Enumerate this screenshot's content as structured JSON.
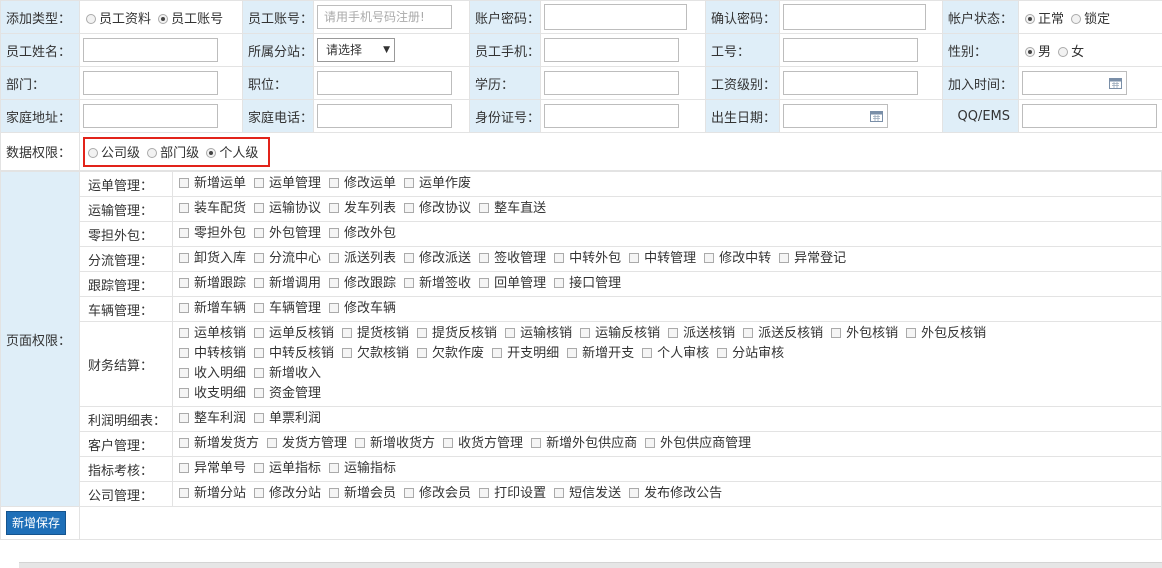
{
  "row1": {
    "add_type_label": "添加类型：",
    "add_type_options": [
      "员工资料",
      "员工账号"
    ],
    "account_label": "员工账号：",
    "account_placeholder": "请用手机号码注册!",
    "password_label": "账户密码：",
    "confirm_label": "确认密码：",
    "status_label": "帐户状态：",
    "status_options": [
      "正常",
      "锁定"
    ]
  },
  "row2": {
    "name_label": "员工姓名：",
    "branch_label": "所属分站：",
    "branch_value": "请选择",
    "mobile_label": "员工手机：",
    "job_no_label": "工号：",
    "gender_label": "性别：",
    "gender_options": [
      "男",
      "女"
    ]
  },
  "row3": {
    "dept_label": "部门：",
    "position_label": "职位：",
    "education_label": "学历：",
    "salary_label": "工资级别：",
    "join_label": "加入时间："
  },
  "row4": {
    "address_label": "家庭地址：",
    "phone_label": "家庭电话：",
    "id_label": "身份证号：",
    "birth_label": "出生日期：",
    "qq_label": "QQ/EMS"
  },
  "data_perm": {
    "label": "数据权限：",
    "options": [
      "公司级",
      "部门级",
      "个人级"
    ]
  },
  "page_perm": {
    "label": "页面权限：",
    "groups": [
      {
        "name": "运单管理：",
        "items": [
          "新增运单",
          "运单管理",
          "修改运单",
          "运单作废"
        ]
      },
      {
        "name": "运输管理：",
        "items": [
          "装车配货",
          "运输协议",
          "发车列表",
          "修改协议",
          "整车直送"
        ]
      },
      {
        "name": "零担外包：",
        "items": [
          "零担外包",
          "外包管理",
          "修改外包"
        ]
      },
      {
        "name": "分流管理：",
        "items": [
          "卸货入库",
          "分流中心",
          "派送列表",
          "修改派送",
          "签收管理",
          "中转外包",
          "中转管理",
          "修改中转",
          "异常登记"
        ]
      },
      {
        "name": "跟踪管理：",
        "items": [
          "新增跟踪",
          "新增调用",
          "修改跟踪",
          "新增签收",
          "回单管理",
          "接口管理"
        ]
      },
      {
        "name": "车辆管理：",
        "items": [
          "新增车辆",
          "车辆管理",
          "修改车辆"
        ]
      },
      {
        "name": "财务结算：",
        "lines": [
          [
            "运单核销",
            "运单反核销",
            "提货核销",
            "提货反核销",
            "运输核销",
            "运输反核销",
            "派送核销",
            "派送反核销",
            "外包核销",
            "外包反核销"
          ],
          [
            "中转核销",
            "中转反核销",
            "欠款核销",
            "欠款作废",
            "开支明细",
            "新增开支",
            "个人审核",
            "分站审核"
          ],
          [
            "收入明细",
            "新增收入"
          ],
          [
            "收支明细",
            "资金管理"
          ]
        ]
      },
      {
        "name": "利润明细表：",
        "items": [
          "整车利润",
          "单票利润"
        ]
      },
      {
        "name": "客户管理：",
        "items": [
          "新增发货方",
          "发货方管理",
          "新增收货方",
          "收货方管理",
          "新增外包供应商",
          "外包供应商管理"
        ]
      },
      {
        "name": "指标考核：",
        "items": [
          "异常单号",
          "运单指标",
          "运输指标"
        ]
      },
      {
        "name": "公司管理：",
        "items": [
          "新增分站",
          "修改分站",
          "新增会员",
          "修改会员",
          "打印设置",
          "短信发送",
          "发布修改公告"
        ]
      }
    ]
  },
  "save_label": "新增保存",
  "icons": {
    "calendar": "calendar-icon",
    "select_caret": "chevron-down-icon"
  },
  "colors": {
    "label_bg": "#dfeef8",
    "highlight_border": "#e2231a",
    "button_bg": "#1e6fb8"
  }
}
